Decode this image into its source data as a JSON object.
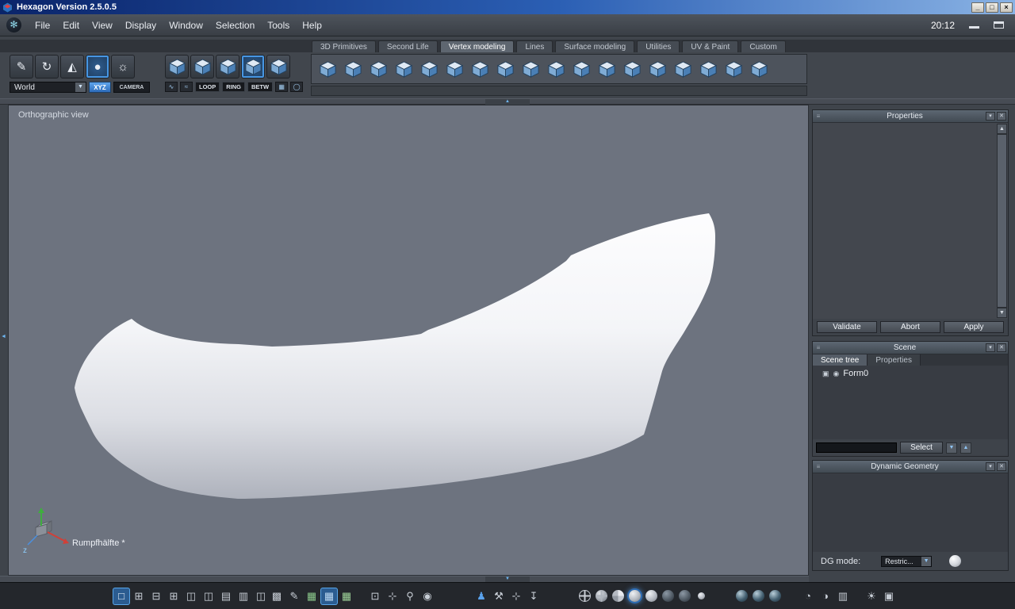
{
  "window": {
    "title": "Hexagon Version 2.5.0.5",
    "controls": {
      "minimize": "_",
      "maximize": "□",
      "close": "×"
    }
  },
  "menubar": {
    "items": [
      {
        "name": "menu-file",
        "label": "File"
      },
      {
        "name": "menu-edit",
        "label": "Edit"
      },
      {
        "name": "menu-view",
        "label": "View"
      },
      {
        "name": "menu-display",
        "label": "Display"
      },
      {
        "name": "menu-window",
        "label": "Window"
      },
      {
        "name": "menu-selection",
        "label": "Selection"
      },
      {
        "name": "menu-tools",
        "label": "Tools"
      },
      {
        "name": "menu-help",
        "label": "Help"
      }
    ],
    "clock": "20:12"
  },
  "tabs": [
    {
      "name": "tab-3d-primitives",
      "label": "3D Primitives"
    },
    {
      "name": "tab-second-life",
      "label": "Second Life"
    },
    {
      "name": "tab-vertex-modeling",
      "label": "Vertex modeling",
      "active": true
    },
    {
      "name": "tab-lines",
      "label": "Lines"
    },
    {
      "name": "tab-surface-modeling",
      "label": "Surface modeling"
    },
    {
      "name": "tab-utilities",
      "label": "Utilities"
    },
    {
      "name": "tab-uv-paint",
      "label": "UV & Paint"
    },
    {
      "name": "tab-custom",
      "label": "Custom"
    }
  ],
  "toolbar": {
    "left_tools": [
      {
        "name": "knife-tool-icon",
        "glyph": "✎"
      },
      {
        "name": "rotate-tool-icon",
        "glyph": "↻"
      },
      {
        "name": "wedge-tool-icon",
        "glyph": "◭"
      },
      {
        "name": "sphere-tool-icon",
        "glyph": "●",
        "active": true
      },
      {
        "name": "lamp-tool-icon",
        "glyph": "☼"
      }
    ],
    "world_select": "World",
    "xyz_button": "XYZ",
    "camera_button": "CAMERA",
    "selection_modes": [
      {
        "name": "select-points-mode-icon"
      },
      {
        "name": "select-edges-mode-icon"
      },
      {
        "name": "select-faces-mode-icon"
      },
      {
        "name": "select-object-mode-icon",
        "active": true
      },
      {
        "name": "select-all-mode-icon"
      }
    ],
    "mini_left": [
      {
        "name": "edge-pick-mini-icon",
        "glyph": "∿"
      },
      {
        "name": "path-pick-mini-icon",
        "glyph": "≈"
      }
    ],
    "loop_button": "LOOP",
    "ring_button": "RING",
    "betw_button": "BETW",
    "mini_right": [
      {
        "name": "grid-mini-icon",
        "glyph": "▦"
      },
      {
        "name": "circle-mini-icon",
        "glyph": "◯"
      }
    ],
    "vertex_tools": [
      {
        "name": "vertex-tool-01-icon"
      },
      {
        "name": "vertex-tool-02-icon"
      },
      {
        "name": "vertex-tool-03-icon"
      },
      {
        "name": "vertex-tool-04-icon"
      },
      {
        "name": "vertex-tool-05-icon"
      },
      {
        "name": "vertex-tool-06-icon"
      },
      {
        "name": "vertex-tool-07-icon"
      },
      {
        "name": "vertex-tool-08-icon"
      },
      {
        "name": "vertex-tool-09-icon"
      },
      {
        "name": "vertex-tool-10-icon"
      },
      {
        "name": "vertex-tool-11-icon"
      },
      {
        "name": "vertex-tool-12-icon"
      },
      {
        "name": "vertex-tool-13-icon"
      },
      {
        "name": "vertex-tool-14-icon"
      },
      {
        "name": "vertex-tool-15-icon"
      },
      {
        "name": "vertex-tool-16-icon"
      },
      {
        "name": "vertex-tool-17-icon"
      },
      {
        "name": "vertex-tool-18-icon"
      }
    ]
  },
  "viewport": {
    "view_label": "Orthographic view",
    "object_label": "Rumpfhälfte *",
    "axis_z_label": "z"
  },
  "panels": {
    "properties": {
      "title": "Properties",
      "validate_button": "Validate",
      "abort_button": "Abort",
      "apply_button": "Apply"
    },
    "scene": {
      "title": "Scene",
      "tabs": [
        {
          "name": "scene-tab-tree",
          "label": "Scene tree",
          "active": true
        },
        {
          "name": "scene-tab-properties",
          "label": "Properties"
        }
      ],
      "items": [
        {
          "label": "Form0"
        }
      ],
      "input_value": "",
      "select_button": "Select"
    },
    "dynamic_geometry": {
      "title": "Dynamic Geometry",
      "dg_mode_label": "DG mode:",
      "dg_mode_value": "Restric..."
    }
  },
  "statusbar": {
    "layout_icons": [
      {
        "name": "layout-single-icon",
        "glyph": "□",
        "active": true
      },
      {
        "name": "layout-quad-icon",
        "glyph": "⊞"
      },
      {
        "name": "layout-two-rows-icon",
        "glyph": "⊟"
      },
      {
        "name": "layout-three-top-icon",
        "glyph": "⊞"
      },
      {
        "name": "layout-two-cols-icon",
        "glyph": "◫"
      },
      {
        "name": "layout-left-split-icon",
        "glyph": "◫"
      },
      {
        "name": "layout-rows-icon",
        "glyph": "▤"
      },
      {
        "name": "layout-stack-icon",
        "glyph": "▥"
      },
      {
        "name": "layout-columns-icon",
        "glyph": "◫"
      }
    ],
    "snap_icons": [
      {
        "name": "uv-edit-icon",
        "glyph": "▩"
      },
      {
        "name": "annotate-icon",
        "glyph": "✎"
      },
      {
        "name": "grid-green-icon",
        "glyph": "▦",
        "color": "#8cc98c"
      },
      {
        "name": "grid-snap-icon",
        "glyph": "▦",
        "active": true,
        "color": "#bcd9f2"
      },
      {
        "name": "grid-plain-icon",
        "glyph": "▦",
        "color": "#9fd49a"
      }
    ],
    "view_icons": [
      {
        "name": "frame-selection-icon",
        "glyph": "⊡"
      },
      {
        "name": "pan-view-icon",
        "glyph": "⊹"
      },
      {
        "name": "zoom-icon",
        "glyph": "⚲"
      },
      {
        "name": "visibility-eye-icon",
        "glyph": "◉"
      }
    ],
    "mode_icons": [
      {
        "name": "avatar-mode-icon",
        "glyph": "♟",
        "color": "#5aa2ec"
      },
      {
        "name": "hammer-tool-icon",
        "glyph": "⚒"
      },
      {
        "name": "axis-manip-icon",
        "glyph": "⊹"
      },
      {
        "name": "drop-to-floor-icon",
        "glyph": "↧"
      }
    ],
    "shading_icons": [
      {
        "name": "wireframe-shading-icon",
        "cls": "wire"
      },
      {
        "name": "wire-shaded-icon",
        "cls": "wire2"
      },
      {
        "name": "flat-shading-icon",
        "cls": "flat"
      },
      {
        "name": "smooth-shading-icon",
        "active": true
      },
      {
        "name": "textured-shading-icon"
      },
      {
        "name": "ghost-shading-icon",
        "cls": "darksp"
      },
      {
        "name": "dark-shading-icon",
        "cls": "darksp"
      },
      {
        "name": "points-shading-icon",
        "cls": "tiny"
      }
    ],
    "material_icons": [
      {
        "name": "material-sphere-icon-1",
        "cls": "mat"
      },
      {
        "name": "material-sphere-icon-2",
        "cls": "mat"
      },
      {
        "name": "material-sphere-icon-3",
        "cls": "mat"
      }
    ],
    "camera_icons": [
      {
        "name": "orbit-view-icon",
        "glyph": "◔"
      },
      {
        "name": "roll-view-icon",
        "glyph": "◑"
      },
      {
        "name": "split-panels-icon",
        "glyph": "▥"
      }
    ],
    "render_icons": [
      {
        "name": "light-icon",
        "glyph": "☀"
      },
      {
        "name": "camera-icon",
        "glyph": "▣"
      }
    ]
  },
  "icons": {
    "logo_glyph": "✻",
    "dropdown_glyph": "▼",
    "grip_glyph": "≡",
    "panel_menu_glyph": "▾",
    "panel_close_glyph": "✕",
    "scroll_up_glyph": "▲",
    "scroll_down_glyph": "▼",
    "collapse_up_glyph": "▲",
    "collapse_down_glyph": "▼",
    "collapse_left_glyph": "◄",
    "spin_down_glyph": "▼",
    "spin_up_glyph": "▲",
    "object_glyph": "▣",
    "eye_glyph": "◉"
  },
  "colors": {
    "accent_blue": "#4796e2",
    "titlebar_blue": "#0a246a",
    "viewport_gray": "#6d737f"
  }
}
